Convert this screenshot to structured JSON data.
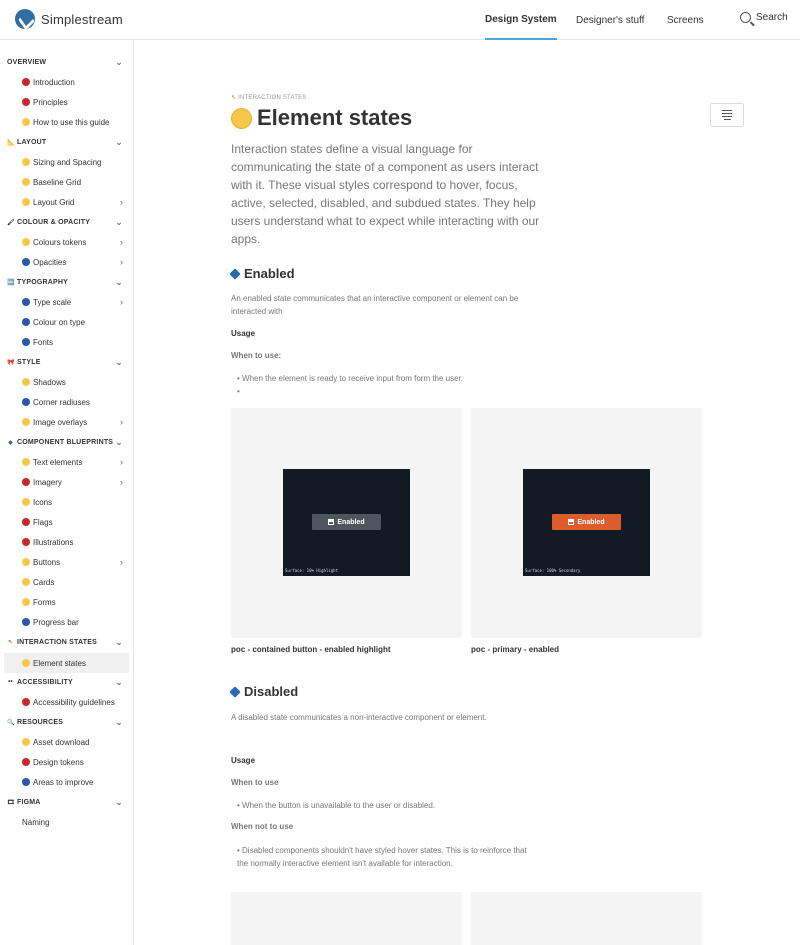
{
  "brand": {
    "name": "Simplestream"
  },
  "topnav": [
    {
      "label": "Design System",
      "active": true
    },
    {
      "label": "Designer's stuff",
      "active": false
    },
    {
      "label": "Screens",
      "active": false
    }
  ],
  "search": {
    "label": "Search"
  },
  "sidebar": {
    "groups": {
      "overview": "OVERVIEW",
      "layout": "LAYOUT",
      "colour": "COLOUR & OPACITY",
      "typography": "TYPOGRAPHY",
      "style": "STYLE",
      "blueprints": "COMPONENT BLUEPRINTS",
      "interaction": "INTERACTION STATES",
      "accessibility": "ACCESSIBILITY",
      "resources": "RESOURCES",
      "figma": "FIGMA"
    },
    "items": {
      "introduction": "Introduction",
      "principles": "Principles",
      "how_to_use": "How to use this guide",
      "sizing": "Sizing and Spacing",
      "baseline": "Baseline Grid",
      "layout_grid": "Layout Grid",
      "colour_tokens": "Colours tokens",
      "opacities": "Opacities",
      "type_scale": "Type scale",
      "colour_on_type": "Colour on type",
      "fonts": "Fonts",
      "shadows": "Shadows",
      "corner_radiuses": "Corner radiuses",
      "image_overlays": "Image overlays",
      "text_elements": "Text elements",
      "imagery": "Imagery",
      "icons": "Icons",
      "flags": "Flags",
      "illustrations": "Illustrations",
      "buttons": "Buttons",
      "cards": "Cards",
      "forms": "Forms",
      "progress_bar": "Progress bar",
      "element_states": "Element states",
      "accessibility_guidelines": "Accessibility guidelines",
      "asset_download": "Asset download",
      "design_tokens": "Design tokens",
      "areas_to_improve": "Areas to improve",
      "naming": "Naming"
    }
  },
  "page": {
    "breadcrumb": "INTERACTION STATES",
    "title": "Element states",
    "lead": "Interaction states define a visual language for communicating the state of a component as users interact with it. These visual styles correspond to hover, focus, active, selected, disabled, and subdued states. They help users understand what to expect while interacting with our apps.",
    "enabled": {
      "heading": "Enabled",
      "description": "An enabled state communicates that an interactive component or element can be interacted with",
      "usage": "Usage",
      "when_to_use": "When to use:",
      "bullet": "When the element is ready to receive input from form the user.",
      "examples": [
        {
          "button_label": "Enabled",
          "surface": "Surface: 10% Highlight",
          "caption": "poc - contained button - enabled highlight"
        },
        {
          "button_label": "Enabled",
          "surface": "Surface: 100% Secondary",
          "caption": "poc - primary - enabled"
        }
      ]
    },
    "disabled": {
      "heading": "Disabled",
      "description": "A disabled state communicates a non-interactive component or element.",
      "usage": "Usage",
      "when_to_use": "When to use",
      "bullet_use": "When the button is unavailable to the user or disabled.",
      "when_not_to_use": "When not to use",
      "bullet_not_use": "Disabled components shouldn't have styled hover states. This is to reinforce that the normally interactive element isn't available for interaction."
    }
  },
  "colors": {
    "accent": "#49a6d9",
    "primary_button": "#dc5c2c",
    "highlight_button": "#4e555c",
    "surface": "#121b23"
  }
}
